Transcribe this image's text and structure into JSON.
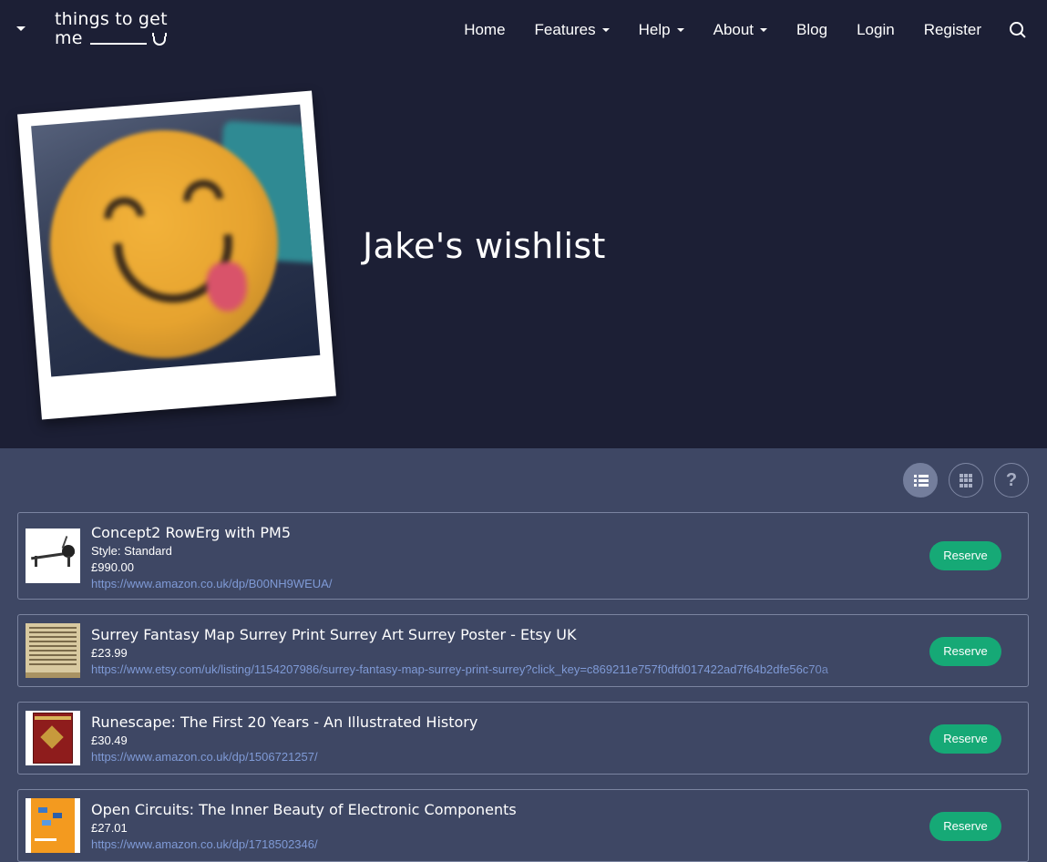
{
  "brand": {
    "line1": "things to get",
    "line2": "me"
  },
  "nav": {
    "items": [
      {
        "label": "Home",
        "dropdown": false
      },
      {
        "label": "Features",
        "dropdown": true
      },
      {
        "label": "Help",
        "dropdown": true
      },
      {
        "label": "About",
        "dropdown": true
      },
      {
        "label": "Blog",
        "dropdown": false
      },
      {
        "label": "Login",
        "dropdown": false
      },
      {
        "label": "Register",
        "dropdown": false
      }
    ],
    "search_icon": "search-icon"
  },
  "profile": {
    "title": "Jake's wishlist"
  },
  "view_controls": {
    "active": "list",
    "buttons": [
      "list-view-icon",
      "grid-view-icon",
      "help-icon"
    ],
    "help_glyph": "?"
  },
  "items": [
    {
      "title": "Concept2 RowErg with PM5",
      "style": "Style: Standard",
      "price": "£990.00",
      "url": "https://www.amazon.co.uk/dp/B00NH9WEUA/",
      "action": "Reserve"
    },
    {
      "title": "Surrey Fantasy Map Surrey Print Surrey Art Surrey Poster - Etsy UK",
      "price": "£23.99",
      "url": "https://www.etsy.com/uk/listing/1154207986/surrey-fantasy-map-surrey-print-surrey?click_key=c869211e757f0dfd017422ad7f64b2dfe56c70a",
      "action": "Reserve"
    },
    {
      "title": "Runescape: The First 20 Years - An Illustrated History",
      "price": "£30.49",
      "url": "https://www.amazon.co.uk/dp/1506721257/",
      "action": "Reserve"
    },
    {
      "title": "Open Circuits: The Inner Beauty of Electronic Components",
      "price": "£27.01",
      "url": "https://www.amazon.co.uk/dp/1718502346/",
      "action": "Reserve"
    }
  ],
  "colors": {
    "header_bg": "#1c1f35",
    "body_bg": "#3e4764",
    "reserve": "#16a976",
    "link": "#7f9ad6"
  }
}
